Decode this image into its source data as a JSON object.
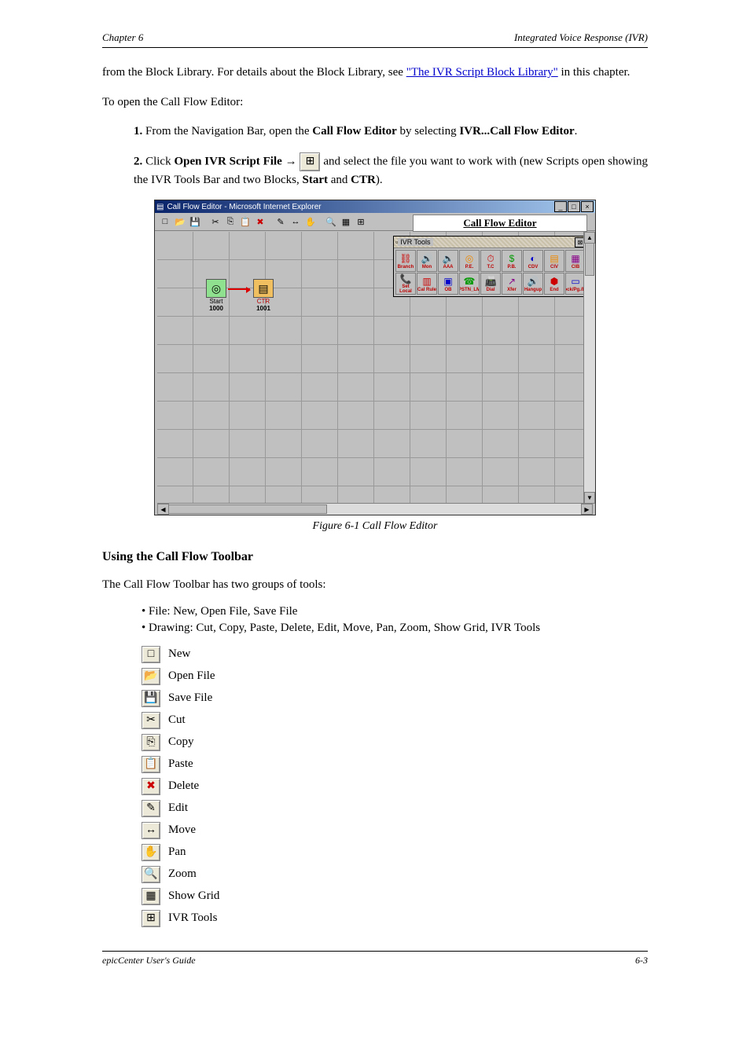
{
  "header": {
    "left": "Chapter 6",
    "right": "Integrated Voice Response (IVR)"
  },
  "para1_a": "from the Block Library. For details about the Block Library, see ",
  "para1_link": "\"The IVR Script Block Library\"",
  "para1_b": " in this chapter.",
  "para2": "To open the Call Flow Editor:",
  "step1_bold": "1. ",
  "step1_a": "From the Navigation Bar, open the ",
  "step1_b": "Call Flow Editor",
  "step1_c": " by selecting ",
  "step1_d": "IVR...Call Flow Editor",
  "step1_e": ".",
  "step2_bold": "2. ",
  "step2_a": "Click ",
  "step2_b": "Open IVR Script File ",
  "step2_c": " and select the file you want to work with (new Scripts open showing the IVR Tools Bar and two Blocks, ",
  "step2_d": "Start",
  "step2_e": " and ",
  "step2_f": "CTR",
  "step2_g": ").",
  "screenshot": {
    "windowTitle": "Call Flow Editor - Microsoft Internet Explorer",
    "editorHeader": "Call Flow Editor",
    "paletteTitle": "IVR Tools",
    "node1": {
      "label": "Start",
      "num": "1000"
    },
    "node2": {
      "label": "CTR",
      "num": "1001"
    },
    "tools": [
      {
        "label": "Branch",
        "color": "red"
      },
      {
        "label": "Mon",
        "color": "blue"
      },
      {
        "label": "AAA",
        "color": "green"
      },
      {
        "label": "P.E.",
        "color": "orange"
      },
      {
        "label": "T.C",
        "color": "red"
      },
      {
        "label": "P.B.",
        "color": "green"
      },
      {
        "label": "CDV",
        "color": "blue"
      },
      {
        "label": "CIV",
        "color": "orange"
      },
      {
        "label": "CIB",
        "color": "purple"
      },
      {
        "label": "Set Local",
        "color": "cyan"
      },
      {
        "label": "Cal Rule",
        "color": "red"
      },
      {
        "label": "OB",
        "color": "blue"
      },
      {
        "label": "PSTN_LM",
        "color": "green"
      },
      {
        "label": "Dial",
        "color": "orange"
      },
      {
        "label": "Xfer",
        "color": "purple"
      },
      {
        "label": "Hangup",
        "color": "red"
      },
      {
        "label": "End",
        "color": "red"
      },
      {
        "label": "Block/Pg./B.R.",
        "color": "blue"
      }
    ]
  },
  "figureLabel": "Figure 6-1 Call Flow Editor",
  "toolbarHeading": "Using the Call Flow Toolbar",
  "toolbarIntro": "The Call Flow Toolbar has two groups of tools:",
  "bullet1": "File: New, Open File, Save File",
  "bullet2": "Drawing: Cut, Copy, Paste, Delete, Edit, Move, Pan, Zoom, Show Grid, IVR Tools",
  "tools": {
    "t0": "New",
    "t1": "Open File",
    "t2": "Save File",
    "t3": "Cut",
    "t4": "Copy",
    "t5": "Paste",
    "t6": "Delete",
    "t7": "Edit",
    "t8": "Move",
    "t9": "Pan",
    "t10": "Zoom",
    "t11": "Show Grid",
    "t12": "IVR Tools"
  },
  "footer": {
    "left": "epicCenter User's Guide",
    "right": "6-3"
  }
}
